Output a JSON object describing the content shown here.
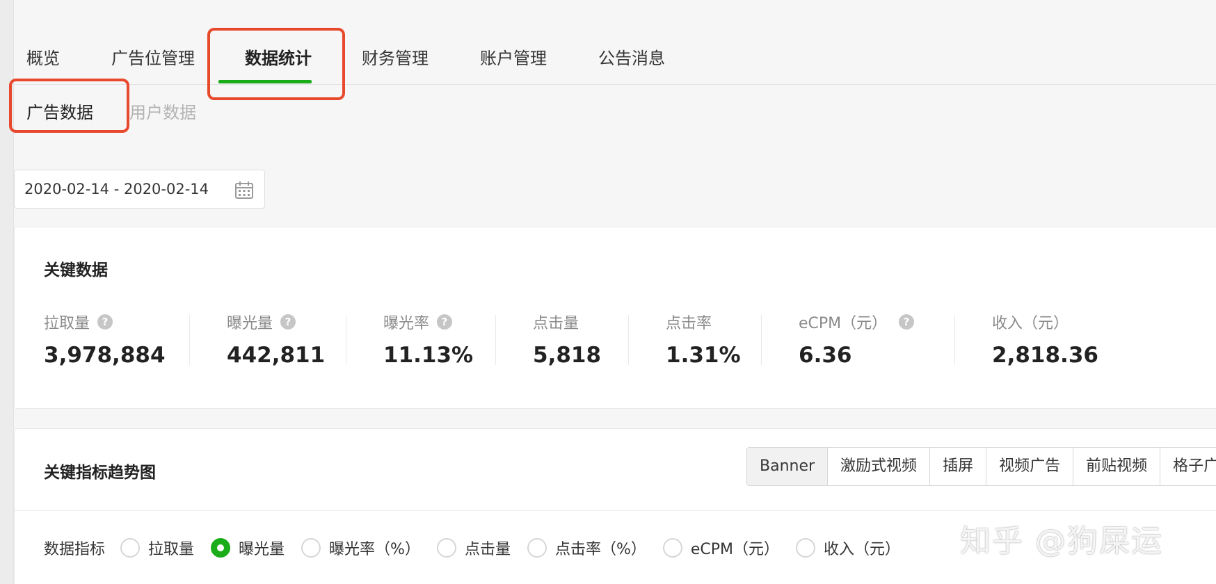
{
  "nav": {
    "items": [
      {
        "label": "概览"
      },
      {
        "label": "广告位管理"
      },
      {
        "label": "数据统计"
      },
      {
        "label": "财务管理"
      },
      {
        "label": "账户管理"
      },
      {
        "label": "公告消息"
      }
    ],
    "active": "数据统计"
  },
  "subnav": {
    "items": [
      {
        "label": "广告数据"
      },
      {
        "label": "用户数据"
      }
    ],
    "active": "广告数据"
  },
  "date_range": {
    "value": "2020-02-14 - 2020-02-14",
    "icon": "calendar-icon"
  },
  "key_data": {
    "title": "关键数据",
    "metrics": [
      {
        "label": "拉取量",
        "value": "3,978,884",
        "help": true
      },
      {
        "label": "曝光量",
        "value": "442,811",
        "help": true
      },
      {
        "label": "曝光率",
        "value": "11.13%",
        "help": true
      },
      {
        "label": "点击量",
        "value": "5,818",
        "help": false
      },
      {
        "label": "点击率",
        "value": "1.31%",
        "help": false
      },
      {
        "label": "eCPM（元）",
        "value": "6.36",
        "help": true
      },
      {
        "label": "收入（元）",
        "value": "2,818.36",
        "help": false
      }
    ]
  },
  "trend": {
    "title": "关键指标趋势图",
    "ad_types": [
      "Banner",
      "激励式视频",
      "插屏",
      "视频广告",
      "前贴视频",
      "格子广告"
    ],
    "active_ad_type": "Banner",
    "filter_label": "数据指标",
    "options": [
      "拉取量",
      "曝光量",
      "曝光率（%）",
      "点击量",
      "点击率（%）",
      "eCPM（元）",
      "收入（元）"
    ],
    "selected_option": "曝光量"
  },
  "watermark": "知乎 @狗屎运",
  "colors": {
    "accent": "#1aad19",
    "annotation": "#e8482c"
  }
}
